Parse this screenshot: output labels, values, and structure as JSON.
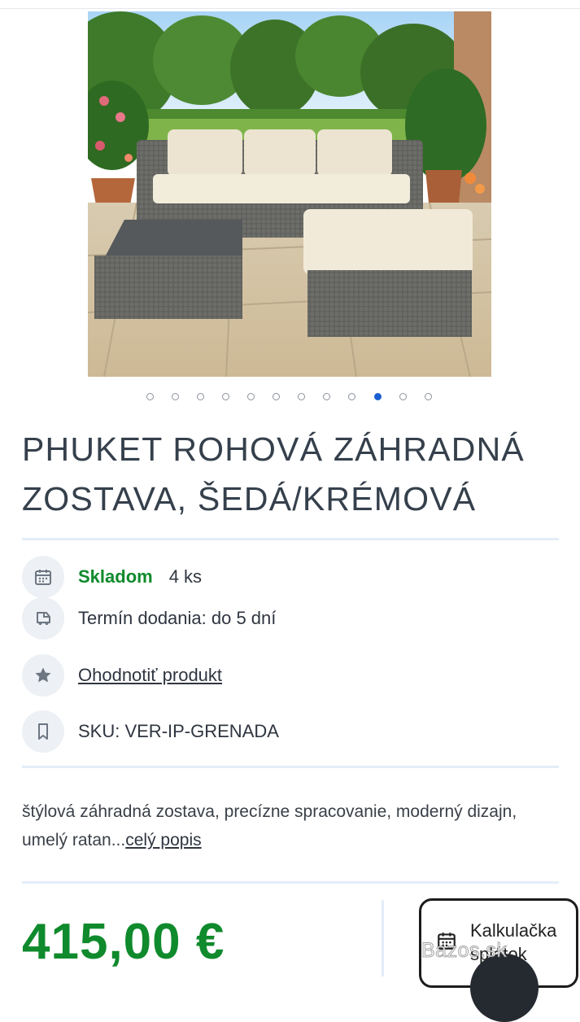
{
  "gallery": {
    "slide_count": 12,
    "active_index": 9
  },
  "product": {
    "title": "PHUKET ROHOVÁ ZÁHRADNÁ ZOSTAVA, ŠEDÁ/KRÉMOVÁ"
  },
  "availability": {
    "stock_label": "Skladom",
    "stock_count": "4 ks",
    "delivery": "Termín dodania: do 5 dní",
    "rate_link": "Ohodnotiť produkt",
    "sku": "SKU: VER-IP-GRENADA"
  },
  "description": {
    "text": "štýlová záhradná zostava, precízne spracovanie, moderný dizajn, umelý ratan...",
    "more_link": "celý popis"
  },
  "pricing": {
    "price": "415,00 €",
    "calculator_label": "Kalkulačka splátok"
  },
  "watermark": "Bazos.sk",
  "icons": [
    "calendar-icon",
    "truck-icon",
    "star-icon",
    "bookmark-icon",
    "calendar-icon"
  ],
  "colors": {
    "accent_green": "#0f8a2c",
    "active_dot": "#1a5fd0",
    "icon_circle": "#edf0f4"
  }
}
